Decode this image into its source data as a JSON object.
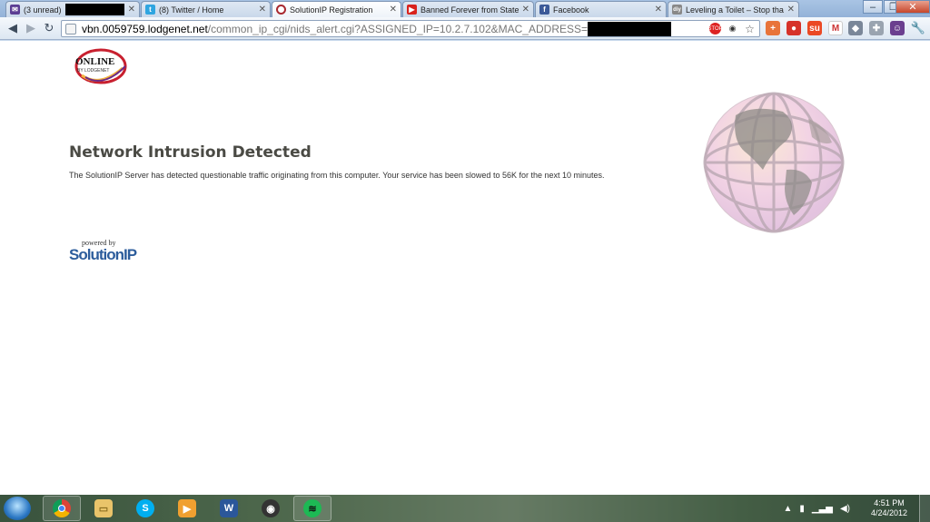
{
  "browser": {
    "tabs": [
      {
        "label": "(3 unread)",
        "favicon": "mail-icon",
        "color": "#5b3d93",
        "redacted": true
      },
      {
        "label": "(8) Twitter / Home",
        "favicon": "twitter-icon",
        "color": "#2fa5e0"
      },
      {
        "label": "SolutionIP Registration",
        "favicon": "target-icon",
        "color": "#a8282f",
        "active": true
      },
      {
        "label": "Banned Forever from State",
        "favicon": "youtube-icon",
        "color": "#d9221c"
      },
      {
        "label": "Facebook",
        "favicon": "facebook-icon",
        "color": "#3b5998"
      },
      {
        "label": "Leveling a Toilet – Stop that",
        "favicon": "diy-icon",
        "color": "#888888"
      }
    ],
    "window_controls": {
      "minimize": "–",
      "maximize": "❐",
      "close": "✕"
    },
    "address_bar": {
      "host": "vbn.0059759.lodgenet.net",
      "path": "/common_ip_cgi/nids_alert.cgi?ASSIGNED_IP=10.2.7.102&MAC_ADDRESS="
    }
  },
  "page": {
    "logo_text": "ONLINE",
    "logo_subtext": "BY LODGENET",
    "heading": "Network Intrusion Detected",
    "message": "The SolutionIP Server has detected questionable traffic originating from this computer. Your service has been slowed to 56K for the next 10 minutes.",
    "powered_by": "powered by",
    "brand": "SolutionIP"
  },
  "taskbar": {
    "time": "4:51 PM",
    "date": "4/24/2012"
  }
}
